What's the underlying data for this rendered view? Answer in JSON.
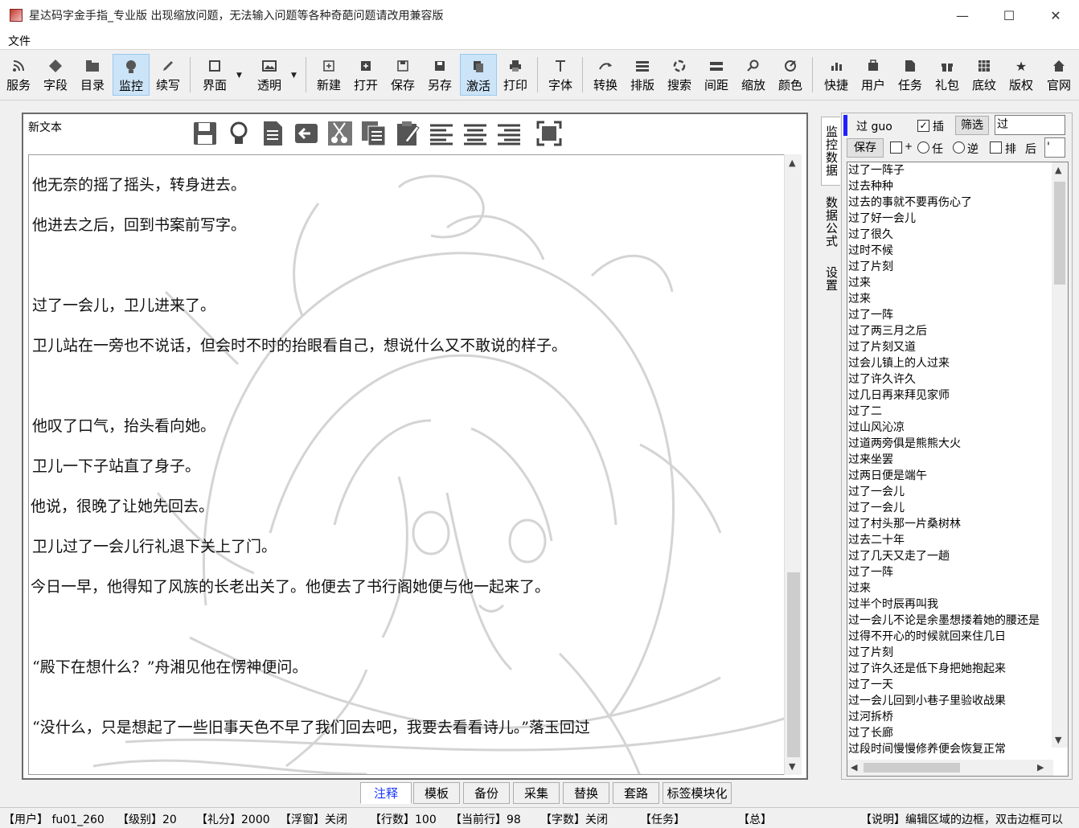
{
  "window": {
    "title": "星达码字金手指_专业版 出现缩放问题，无法输入问题等各种奇葩问题请改用兼容版",
    "minimize": "—",
    "maximize": "☐",
    "close": "✕"
  },
  "menu": {
    "file": "文件"
  },
  "toolbar": {
    "items": [
      {
        "label": "服务",
        "icon": "rss-icon"
      },
      {
        "label": "字段",
        "icon": "diamond-icon"
      },
      {
        "label": "目录",
        "icon": "folder-icon"
      },
      {
        "label": "监控",
        "icon": "monitor-icon",
        "active": true
      },
      {
        "label": "续写",
        "icon": "pen-icon"
      },
      {
        "label": "界面",
        "icon": "window-icon"
      },
      {
        "label": "透明",
        "icon": "image-icon"
      },
      {
        "label": "新建",
        "icon": "new-icon"
      },
      {
        "label": "打开",
        "icon": "open-icon"
      },
      {
        "label": "保存",
        "icon": "save-icon"
      },
      {
        "label": "另存",
        "icon": "save-as-icon"
      },
      {
        "label": "激活",
        "icon": "activate-icon",
        "active": true
      },
      {
        "label": "打印",
        "icon": "print-icon"
      },
      {
        "label": "字体",
        "icon": "font-icon"
      },
      {
        "label": "转换",
        "icon": "convert-icon"
      },
      {
        "label": "排版",
        "icon": "layout-icon"
      },
      {
        "label": "搜索",
        "icon": "search-icon"
      },
      {
        "label": "间距",
        "icon": "spacing-icon"
      },
      {
        "label": "缩放",
        "icon": "zoom-icon"
      },
      {
        "label": "颜色",
        "icon": "color-icon"
      },
      {
        "label": "快捷",
        "icon": "shortcut-icon"
      },
      {
        "label": "用户",
        "icon": "user-icon"
      },
      {
        "label": "任务",
        "icon": "task-icon"
      },
      {
        "label": "礼包",
        "icon": "gift-icon"
      },
      {
        "label": "底纹",
        "icon": "texture-icon"
      },
      {
        "label": "版权",
        "icon": "star-icon"
      },
      {
        "label": "官网",
        "icon": "home-icon"
      }
    ]
  },
  "editor": {
    "doc_title": "新文本",
    "lines": [
      " 他无奈的摇了摇头，转身进去。",
      " 他进去之后，回到书案前写字。",
      " 过了一会儿，卫儿进来了。",
      "   卫儿站在一旁也不说话，但会时不时的抬眼看自己，想说什么又不敢说的样子。",
      " 他叹了口气，抬头看向她。",
      " 卫儿一下子站直了身子。",
      "他说，很晚了让她先回去。",
      " 卫儿过了一会儿行礼退下关上了门。",
      "今日一早，他得知了风族的长老出关了。他便去了书行阁她便与他一起来了。",
      "“殿下在想什么？”舟湘见他在愣神便问。",
      "“没什么，只是想起了一些旧事天色不早了我们回去吧，我要去看看诗儿。”落玉回过"
    ]
  },
  "side_tabs": [
    "监控数据",
    "数据公式",
    "设置"
  ],
  "monitor": {
    "key_label": "过 guo",
    "insert_label": "插",
    "insert_checked": true,
    "filter_button": "筛选",
    "filter_value": "过",
    "save_button": "保存",
    "plus_label": "+",
    "any_label": "任",
    "reverse_label": "逆",
    "sort_label": "排",
    "after_label": "后",
    "after_value": "'",
    "items": [
      "过了一阵子",
      "过去种种",
      "过去的事就不要再伤心了",
      "过了好一会儿",
      "过了很久",
      "过时不候",
      "过了片刻",
      "过来",
      "过来",
      "过了一阵",
      "过了两三月之后",
      "过了片刻又道",
      "过会儿镇上的人过来",
      "过了许久许久",
      "过几日再来拜见家师",
      "过了二",
      "过山风沁凉",
      "过道两旁俱是熊熊大火",
      "过来坐罢",
      "过两日便是端午",
      "过了一会儿",
      "过了一会儿",
      "过了村头那一片桑树林",
      "过去二十年",
      "过了几天又走了一趟",
      "过了一阵",
      "过来",
      "过半个时辰再叫我",
      "过一会儿不论是余墨想搂着她的腰还是",
      "过得不开心的时候就回来住几日",
      "过了片刻",
      "过了许久还是低下身把她抱起来",
      "过了一天",
      "过一会儿回到小巷子里验收战果",
      "过河拆桥",
      "过了长廊",
      "过段时间慢慢修养便会恢复正常"
    ]
  },
  "bottom_tabs": [
    "注释",
    "模板",
    "备份",
    "采集",
    "替换",
    "套路",
    "标签模块化"
  ],
  "status": {
    "user": "【用户】 fu01_260",
    "level": "【级别】20",
    "points": "【礼分】2000",
    "float": "【浮窗】关闭",
    "rows": "【行数】100",
    "current_row": "【当前行】98",
    "char_count": "【字数】关闭",
    "task": "【任务】",
    "total": "【总】",
    "note": "【说明】编辑区域的边框，双击边框可以"
  }
}
